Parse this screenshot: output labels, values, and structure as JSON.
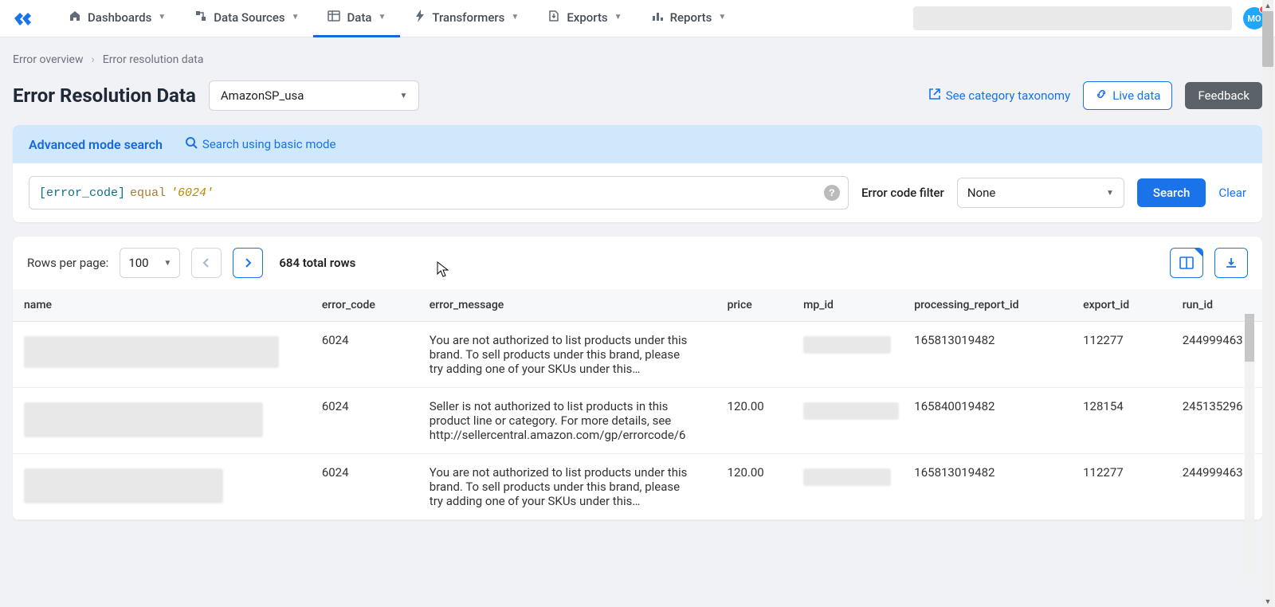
{
  "nav": {
    "items": [
      {
        "label": "Dashboards"
      },
      {
        "label": "Data Sources"
      },
      {
        "label": "Data"
      },
      {
        "label": "Transformers"
      },
      {
        "label": "Exports"
      },
      {
        "label": "Reports"
      }
    ],
    "avatar_initials": "MO"
  },
  "breadcrumb": {
    "items": [
      "Error overview",
      "Error resolution data"
    ]
  },
  "page": {
    "title": "Error Resolution Data",
    "source_select": "AmazonSP_usa",
    "see_taxonomy": "See category taxonomy",
    "live_data": "Live data",
    "feedback": "Feedback"
  },
  "search": {
    "mode_title": "Advanced mode search",
    "switch_label": "Search using basic mode",
    "query_field": "[error_code]",
    "query_op": "equal",
    "query_val": "'6024'",
    "filter_label": "Error code filter",
    "filter_value": "None",
    "search_btn": "Search",
    "clear_btn": "Clear"
  },
  "pager": {
    "rows_per_page_label": "Rows per page:",
    "rows_per_page_value": "100",
    "total_label": "684 total rows"
  },
  "table": {
    "columns": [
      "name",
      "error_code",
      "error_message",
      "price",
      "mp_id",
      "processing_report_id",
      "export_id",
      "run_id"
    ],
    "rows": [
      {
        "error_code": "6024",
        "error_message": "You are not authorized to list products under this brand. To sell products under this brand, please try adding one of your SKUs under this…",
        "price": "",
        "processing_report_id": "165813019482",
        "export_id": "112277",
        "run_id": "244999463"
      },
      {
        "error_code": "6024",
        "error_message": "Seller is not authorized to list products in this product line or category. For more details, see http://sellercentral.amazon.com/gp/errorcode/6",
        "price": "120.00",
        "processing_report_id": "165840019482",
        "export_id": "128154",
        "run_id": "245135296"
      },
      {
        "error_code": "6024",
        "error_message": "You are not authorized to list products under this brand. To sell products under this brand, please try adding one of your SKUs under this…",
        "price": "120.00",
        "processing_report_id": "165813019482",
        "export_id": "112277",
        "run_id": "244999463"
      }
    ]
  }
}
